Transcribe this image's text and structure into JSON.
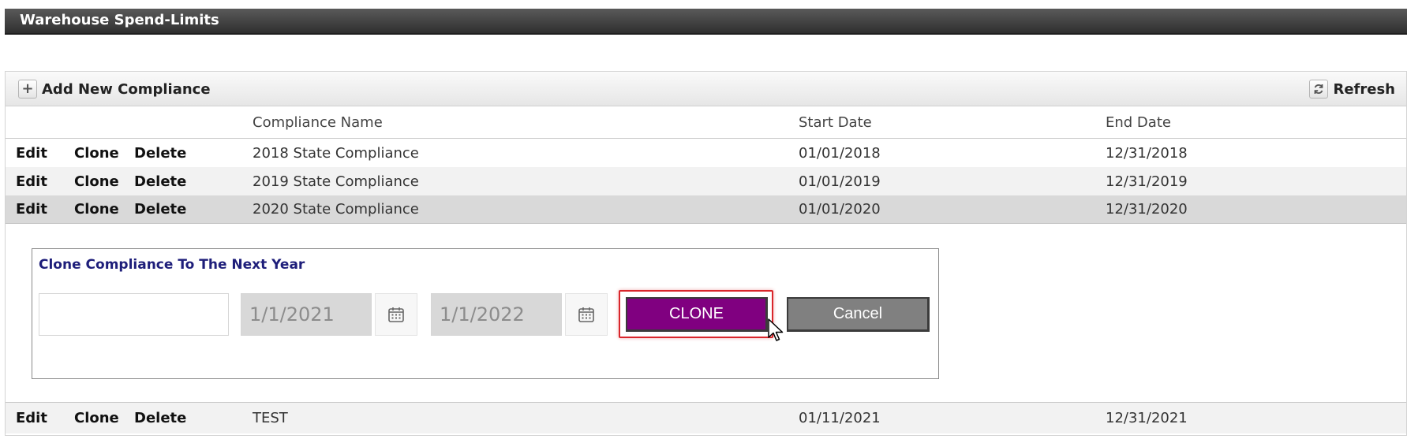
{
  "header": {
    "title": "Warehouse Spend-Limits"
  },
  "toolbar": {
    "add_label": "Add New Compliance",
    "add_icon": "+",
    "refresh_label": "Refresh"
  },
  "columns": {
    "name": "Compliance Name",
    "start": "Start Date",
    "end": "End Date"
  },
  "actions": {
    "edit": "Edit",
    "clone": "Clone",
    "delete": "Delete"
  },
  "rows": [
    {
      "name": "2018 State Compliance",
      "start": "01/01/2018",
      "end": "12/31/2018"
    },
    {
      "name": "2019 State Compliance",
      "start": "01/01/2019",
      "end": "12/31/2019"
    },
    {
      "name": "2020 State Compliance",
      "start": "01/01/2020",
      "end": "12/31/2020"
    },
    {
      "name": "TEST",
      "start": "01/11/2021",
      "end": "12/31/2021"
    }
  ],
  "clone_panel": {
    "title": "Clone Compliance To The Next Year",
    "name_value": "",
    "start_value": "1/1/2021",
    "end_value": "1/1/2022",
    "clone_label": "CLONE",
    "cancel_label": "Cancel"
  },
  "colors": {
    "clone_button": "#800080",
    "cancel_button": "#808080",
    "panel_title": "#1e1e7a",
    "highlight_frame": "#d9262b"
  }
}
